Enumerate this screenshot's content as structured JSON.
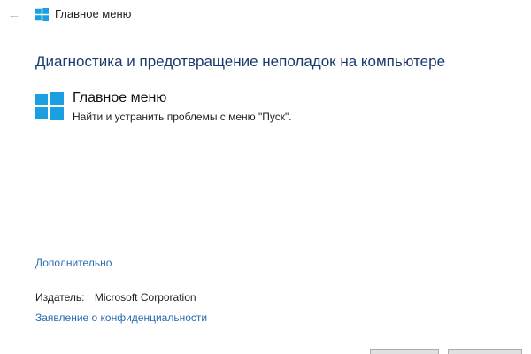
{
  "window": {
    "title": "Главное меню"
  },
  "header": {
    "heading": "Диагностика и предотвращение неполадок на компьютере"
  },
  "troubleshooter": {
    "title": "Главное меню",
    "description": "Найти и устранить проблемы с меню \"Пуск\"."
  },
  "links": {
    "advanced": "Дополнительно",
    "privacy": "Заявление о конфиденциальности"
  },
  "publisher": {
    "label": "Издатель:",
    "value": "Microsoft Corporation"
  },
  "icons": {
    "back": "back-arrow-icon",
    "windows_logo": "windows-logo-icon"
  },
  "colors": {
    "windows_logo": "#1aa0e0",
    "heading": "#1a3a6e",
    "link": "#2b6cb0"
  }
}
